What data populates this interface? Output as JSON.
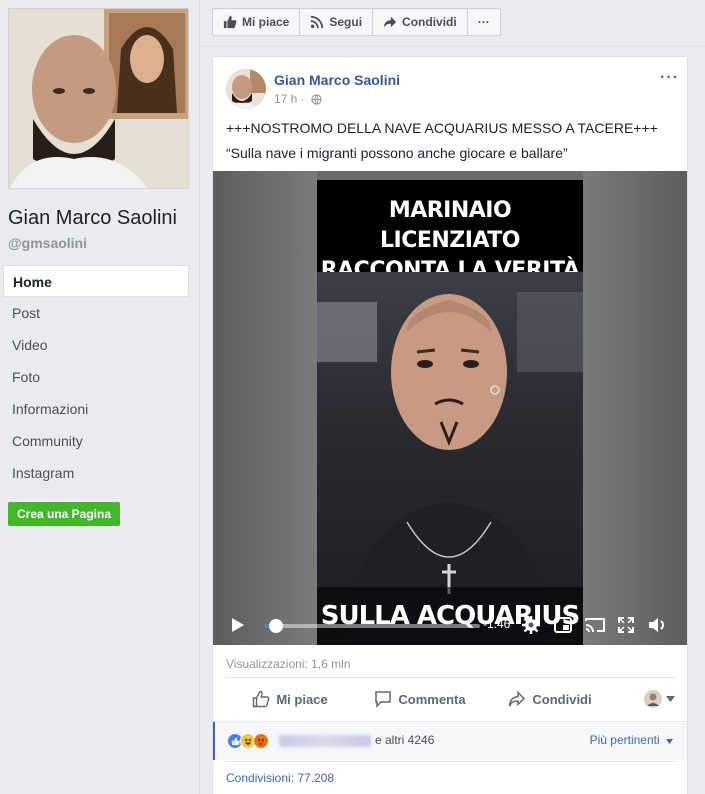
{
  "sidebar": {
    "page_name": "Gian Marco Saolini",
    "handle": "@gmsaolini",
    "nav": [
      {
        "label": "Home"
      },
      {
        "label": "Post"
      },
      {
        "label": "Video"
      },
      {
        "label": "Foto"
      },
      {
        "label": "Informazioni"
      },
      {
        "label": "Community"
      },
      {
        "label": "Instagram"
      }
    ],
    "create_page_label": "Crea una Pagina"
  },
  "action_bar": {
    "like_label": "Mi piace",
    "follow_label": "Segui",
    "share_label": "Condividi",
    "more_label": "···"
  },
  "post": {
    "author": "Gian Marco Saolini",
    "time": "17 h",
    "separator": "·",
    "text_line1": "+++NOSTROMO DELLA NAVE ACQUARIUS MESSO A TACERE+++",
    "text_line2": "“Sulla nave i migranti possono anche giocare e ballare”",
    "menu_label": "···",
    "video": {
      "title_line1": "MARINAIO LICENZIATO",
      "title_line2": "RACCONTA LA VERITÀ",
      "caption": "SULLA ACQUARIUS",
      "time_remaining": "-1:46",
      "progress_fraction": 0.05
    },
    "views": "Visualizzazioni: 1,6 mln",
    "actions": {
      "like": "Mi piace",
      "comment": "Commenta",
      "share": "Condividi"
    },
    "reactions_text": "e altri 4246",
    "relevance": "Più pertinenti",
    "shares": "Condivisioni: 77.208"
  },
  "colors": {
    "fb_blue": "#4267b2",
    "link_blue": "#365899",
    "green": "#42b72a"
  }
}
